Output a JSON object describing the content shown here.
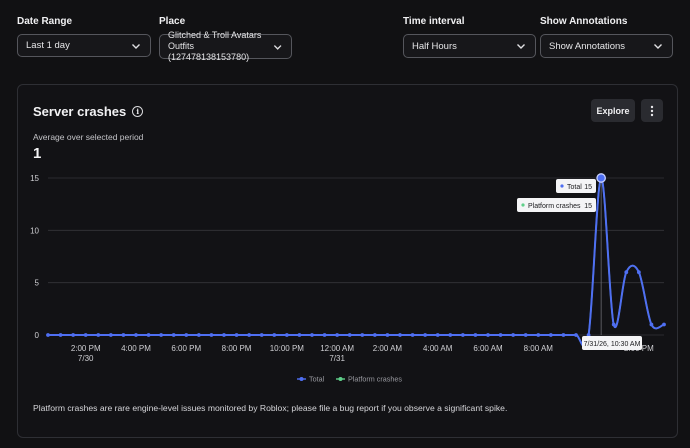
{
  "filters": {
    "date_range": {
      "label": "Date Range",
      "value": "Last 1 day"
    },
    "place": {
      "label": "Place",
      "value_line1": "Glitched & Troll Avatars",
      "value_line2": "Outfits (127478138153780)"
    },
    "time_interval": {
      "label": "Time interval",
      "value": "Half Hours"
    },
    "annotations": {
      "label": "Show Annotations",
      "value": "Show Annotations"
    }
  },
  "card": {
    "title": "Server crashes",
    "explore_label": "Explore",
    "subtitle": "Average over selected period",
    "average_value": "1",
    "footnote": "Platform crashes are rare engine-level issues monitored by Roblox; please file a bug report if you observe a significant spike."
  },
  "tooltip": {
    "time": "7/31/26, 10:30 AM",
    "rows": [
      {
        "name": "Total",
        "value": "15"
      },
      {
        "name": "Platform crashes",
        "value": "15"
      }
    ]
  },
  "colors": {
    "total": "#4f6ff2",
    "platform": "#5fd08a",
    "grid": "#34353a"
  },
  "chart_data": {
    "type": "line",
    "ylim": [
      0,
      15
    ],
    "yticks": [
      0,
      5,
      10,
      15
    ],
    "xlim": [
      12.5,
      37.0
    ],
    "x_tick_labels": [
      {
        "x": 14,
        "line1": "2:00 PM",
        "line2": "7/30"
      },
      {
        "x": 16,
        "line1": "4:00 PM",
        "line2": ""
      },
      {
        "x": 18,
        "line1": "6:00 PM",
        "line2": ""
      },
      {
        "x": 20,
        "line1": "8:00 PM",
        "line2": ""
      },
      {
        "x": 22,
        "line1": "10:00 PM",
        "line2": ""
      },
      {
        "x": 24,
        "line1": "12:00 AM",
        "line2": "7/31"
      },
      {
        "x": 26,
        "line1": "2:00 AM",
        "line2": ""
      },
      {
        "x": 28,
        "line1": "4:00 AM",
        "line2": ""
      },
      {
        "x": 30,
        "line1": "6:00 AM",
        "line2": ""
      },
      {
        "x": 32,
        "line1": "8:00 AM",
        "line2": ""
      },
      {
        "x": 36,
        "line1": "2:00 PM",
        "line2": ""
      }
    ],
    "x": [
      12.5,
      13.0,
      13.5,
      14.0,
      14.5,
      15.0,
      15.5,
      16.0,
      16.5,
      17.0,
      17.5,
      18.0,
      18.5,
      19.0,
      19.5,
      20.0,
      20.5,
      21.0,
      21.5,
      22.0,
      22.5,
      23.0,
      23.5,
      24.0,
      24.5,
      25.0,
      25.5,
      26.0,
      26.5,
      27.0,
      27.5,
      28.0,
      28.5,
      29.0,
      29.5,
      30.0,
      30.5,
      31.0,
      31.5,
      32.0,
      32.5,
      33.0,
      33.5,
      34.0,
      34.5,
      35.0,
      35.5,
      36.0,
      36.5,
      37.0
    ],
    "series": [
      {
        "name": "Total",
        "values": [
          0,
          0,
          0,
          0,
          0,
          0,
          0,
          0,
          0,
          0,
          0,
          0,
          0,
          0,
          0,
          0,
          0,
          0,
          0,
          0,
          0,
          0,
          0,
          0,
          0,
          0,
          0,
          0,
          0,
          0,
          0,
          0,
          0,
          0,
          0,
          0,
          0,
          0,
          0,
          0,
          0,
          0,
          0,
          0,
          15,
          1,
          6,
          6,
          1,
          1
        ]
      },
      {
        "name": "Platform crashes",
        "values": [
          0,
          0,
          0,
          0,
          0,
          0,
          0,
          0,
          0,
          0,
          0,
          0,
          0,
          0,
          0,
          0,
          0,
          0,
          0,
          0,
          0,
          0,
          0,
          0,
          0,
          0,
          0,
          0,
          0,
          0,
          0,
          0,
          0,
          0,
          0,
          0,
          0,
          0,
          0,
          0,
          0,
          0,
          0,
          0,
          15,
          1,
          6,
          6,
          1,
          1
        ]
      }
    ],
    "highlight_x": 34.5,
    "grid": true,
    "legend": "bottom-center"
  }
}
